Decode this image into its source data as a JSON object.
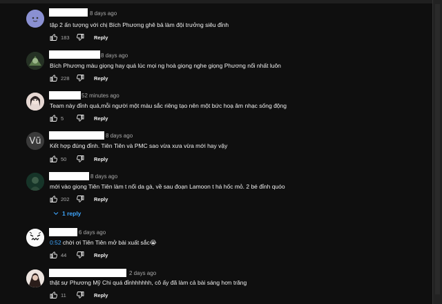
{
  "comments": [
    {
      "time": "8 days ago",
      "text": "tập 2 ấn tượng với chị Bích Phương ghê bả làm đội trưởng siêu đỉnh",
      "likes": "183",
      "reply": "Reply"
    },
    {
      "time": "8 days ago",
      "text": "Bích Phương màu giọng hay quá lúc mọi ng hoà giọng nghe giọng Phương nổi nhất luôn",
      "likes": "228",
      "reply": "Reply"
    },
    {
      "time": "52 minutes ago",
      "text": "Team này đỉnh quá,mỗi người một màu sắc riêng tạo nên một bức hoạ âm nhạc sống động",
      "likes": "5",
      "reply": "Reply"
    },
    {
      "time": "8 days ago",
      "avatar_letter": "Vũ",
      "text": "Kết hợp đúng đỉnh. Tiên Tiên và PMC sao vừa xưa vừa mới hay vậy",
      "likes": "50",
      "reply": "Reply"
    },
    {
      "time": "8 days ago",
      "text": "mới vào giọng Tiên Tiên làm t nổi da gà, về sau đoạn Lamoon t há hốc mỏ. 2 bé đỉnh quóo",
      "likes": "202",
      "reply": "Reply",
      "replies_label": "1 reply"
    },
    {
      "time": "6 days ago",
      "timestamp": "0:52",
      "text": " chời ơi Tiên Tiên mở bài xuất sắc😭",
      "likes": "44",
      "reply": "Reply"
    },
    {
      "time": "2 days ago",
      "text": "thật sự Phương Mỹ Chi quá đỉnhhhhhh, cô ấy đã làm cả bài sáng hơn trăng",
      "likes": "11",
      "reply": "Reply"
    }
  ],
  "colors": {
    "background": "#0f0f0f",
    "text": "#f1f1f1",
    "secondary": "#aaaaaa",
    "link": "#3ea6ff"
  },
  "icons": {
    "like": "thumb-up-icon",
    "dislike": "thumb-down-icon",
    "expand": "chevron-down-icon"
  }
}
